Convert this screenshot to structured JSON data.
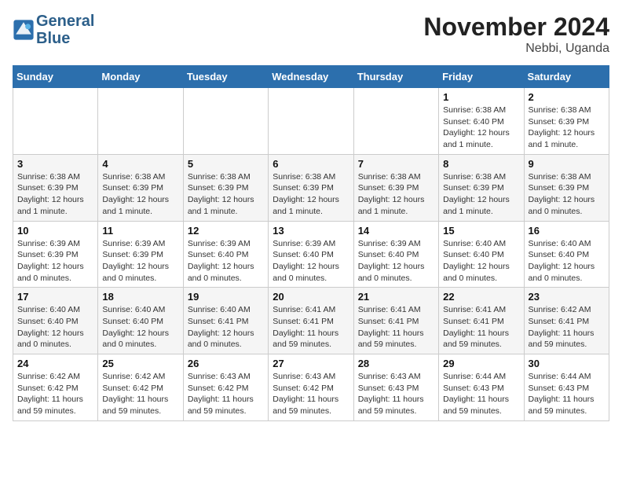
{
  "header": {
    "logo_line1": "General",
    "logo_line2": "Blue",
    "month": "November 2024",
    "location": "Nebbi, Uganda"
  },
  "weekdays": [
    "Sunday",
    "Monday",
    "Tuesday",
    "Wednesday",
    "Thursday",
    "Friday",
    "Saturday"
  ],
  "weeks": [
    [
      {
        "day": "",
        "info": ""
      },
      {
        "day": "",
        "info": ""
      },
      {
        "day": "",
        "info": ""
      },
      {
        "day": "",
        "info": ""
      },
      {
        "day": "",
        "info": ""
      },
      {
        "day": "1",
        "info": "Sunrise: 6:38 AM\nSunset: 6:40 PM\nDaylight: 12 hours and 1 minute."
      },
      {
        "day": "2",
        "info": "Sunrise: 6:38 AM\nSunset: 6:39 PM\nDaylight: 12 hours and 1 minute."
      }
    ],
    [
      {
        "day": "3",
        "info": "Sunrise: 6:38 AM\nSunset: 6:39 PM\nDaylight: 12 hours and 1 minute."
      },
      {
        "day": "4",
        "info": "Sunrise: 6:38 AM\nSunset: 6:39 PM\nDaylight: 12 hours and 1 minute."
      },
      {
        "day": "5",
        "info": "Sunrise: 6:38 AM\nSunset: 6:39 PM\nDaylight: 12 hours and 1 minute."
      },
      {
        "day": "6",
        "info": "Sunrise: 6:38 AM\nSunset: 6:39 PM\nDaylight: 12 hours and 1 minute."
      },
      {
        "day": "7",
        "info": "Sunrise: 6:38 AM\nSunset: 6:39 PM\nDaylight: 12 hours and 1 minute."
      },
      {
        "day": "8",
        "info": "Sunrise: 6:38 AM\nSunset: 6:39 PM\nDaylight: 12 hours and 1 minute."
      },
      {
        "day": "9",
        "info": "Sunrise: 6:38 AM\nSunset: 6:39 PM\nDaylight: 12 hours and 0 minutes."
      }
    ],
    [
      {
        "day": "10",
        "info": "Sunrise: 6:39 AM\nSunset: 6:39 PM\nDaylight: 12 hours and 0 minutes."
      },
      {
        "day": "11",
        "info": "Sunrise: 6:39 AM\nSunset: 6:39 PM\nDaylight: 12 hours and 0 minutes."
      },
      {
        "day": "12",
        "info": "Sunrise: 6:39 AM\nSunset: 6:40 PM\nDaylight: 12 hours and 0 minutes."
      },
      {
        "day": "13",
        "info": "Sunrise: 6:39 AM\nSunset: 6:40 PM\nDaylight: 12 hours and 0 minutes."
      },
      {
        "day": "14",
        "info": "Sunrise: 6:39 AM\nSunset: 6:40 PM\nDaylight: 12 hours and 0 minutes."
      },
      {
        "day": "15",
        "info": "Sunrise: 6:40 AM\nSunset: 6:40 PM\nDaylight: 12 hours and 0 minutes."
      },
      {
        "day": "16",
        "info": "Sunrise: 6:40 AM\nSunset: 6:40 PM\nDaylight: 12 hours and 0 minutes."
      }
    ],
    [
      {
        "day": "17",
        "info": "Sunrise: 6:40 AM\nSunset: 6:40 PM\nDaylight: 12 hours and 0 minutes."
      },
      {
        "day": "18",
        "info": "Sunrise: 6:40 AM\nSunset: 6:40 PM\nDaylight: 12 hours and 0 minutes."
      },
      {
        "day": "19",
        "info": "Sunrise: 6:40 AM\nSunset: 6:41 PM\nDaylight: 12 hours and 0 minutes."
      },
      {
        "day": "20",
        "info": "Sunrise: 6:41 AM\nSunset: 6:41 PM\nDaylight: 11 hours and 59 minutes."
      },
      {
        "day": "21",
        "info": "Sunrise: 6:41 AM\nSunset: 6:41 PM\nDaylight: 11 hours and 59 minutes."
      },
      {
        "day": "22",
        "info": "Sunrise: 6:41 AM\nSunset: 6:41 PM\nDaylight: 11 hours and 59 minutes."
      },
      {
        "day": "23",
        "info": "Sunrise: 6:42 AM\nSunset: 6:41 PM\nDaylight: 11 hours and 59 minutes."
      }
    ],
    [
      {
        "day": "24",
        "info": "Sunrise: 6:42 AM\nSunset: 6:42 PM\nDaylight: 11 hours and 59 minutes."
      },
      {
        "day": "25",
        "info": "Sunrise: 6:42 AM\nSunset: 6:42 PM\nDaylight: 11 hours and 59 minutes."
      },
      {
        "day": "26",
        "info": "Sunrise: 6:43 AM\nSunset: 6:42 PM\nDaylight: 11 hours and 59 minutes."
      },
      {
        "day": "27",
        "info": "Sunrise: 6:43 AM\nSunset: 6:42 PM\nDaylight: 11 hours and 59 minutes."
      },
      {
        "day": "28",
        "info": "Sunrise: 6:43 AM\nSunset: 6:43 PM\nDaylight: 11 hours and 59 minutes."
      },
      {
        "day": "29",
        "info": "Sunrise: 6:44 AM\nSunset: 6:43 PM\nDaylight: 11 hours and 59 minutes."
      },
      {
        "day": "30",
        "info": "Sunrise: 6:44 AM\nSunset: 6:43 PM\nDaylight: 11 hours and 59 minutes."
      }
    ]
  ]
}
